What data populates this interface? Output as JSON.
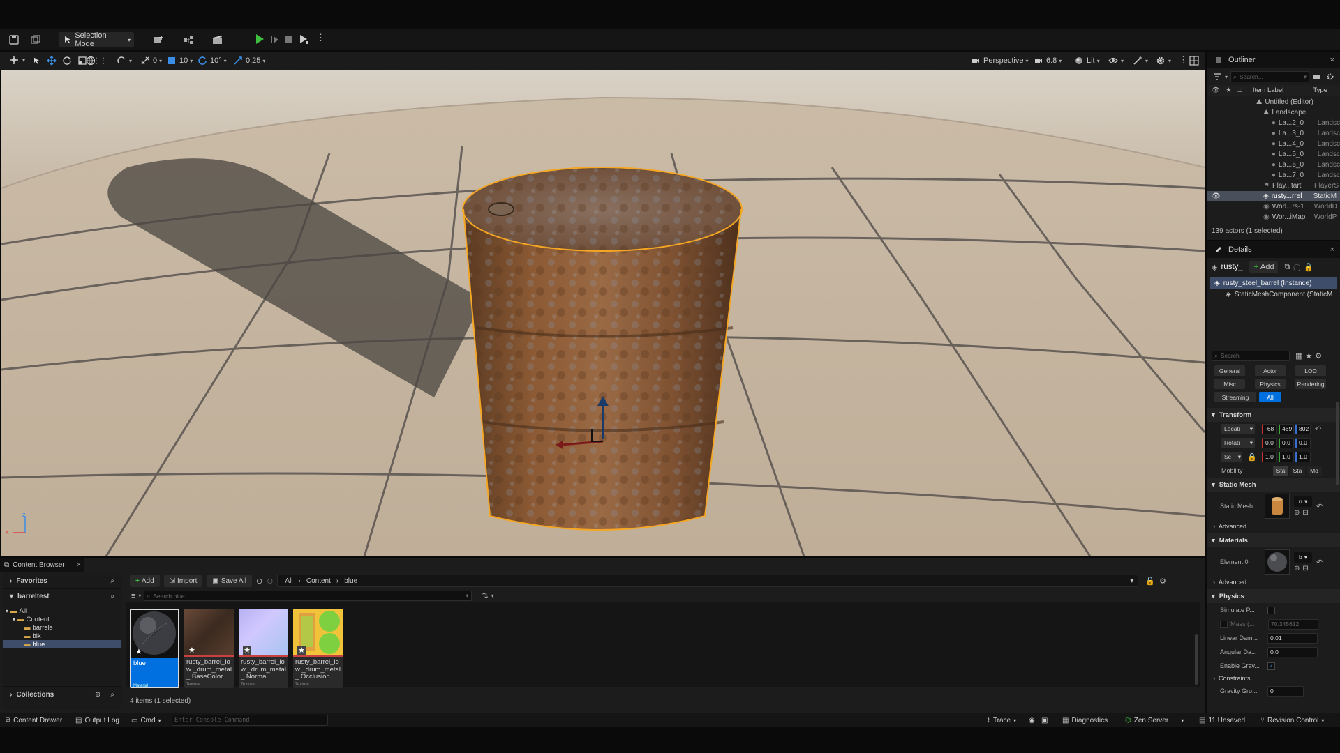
{
  "toolbar": {
    "selection_mode": "Selection Mode",
    "grid_snap": "0",
    "grid_size": "10",
    "rotation_snap": "10°",
    "scale_snap": "0.25"
  },
  "viewport": {
    "perspective": "Perspective",
    "camera_speed": "6.8",
    "view_mode": "Lit"
  },
  "outliner": {
    "tab": "Outliner",
    "search_placeholder": "Search...",
    "col_label": "Item Label",
    "col_type": "Type",
    "rows": [
      {
        "label": "Untitled (Editor)",
        "type": "",
        "indent": 0
      },
      {
        "label": "Landscape",
        "type": "",
        "indent": 1
      },
      {
        "label": "La...2_0",
        "type": "Landsc",
        "indent": 2
      },
      {
        "label": "La...3_0",
        "type": "Landsc",
        "indent": 2
      },
      {
        "label": "La...4_0",
        "type": "Landsc",
        "indent": 2
      },
      {
        "label": "La...5_0",
        "type": "Landsc",
        "indent": 2
      },
      {
        "label": "La...6_0",
        "type": "Landsc",
        "indent": 2
      },
      {
        "label": "La...7_0",
        "type": "Landsc",
        "indent": 2
      },
      {
        "label": "Play...tart",
        "type": "PlayerS",
        "indent": 1
      },
      {
        "label": "rusty...rrel",
        "type": "StaticM",
        "indent": 1,
        "selected": true
      },
      {
        "label": "Worl...rs-1",
        "type": "WorldD",
        "indent": 1
      },
      {
        "label": "Wor...iMap",
        "type": "WorldP",
        "indent": 1
      }
    ],
    "status": "139 actors (1 selected)"
  },
  "details": {
    "tab": "Details",
    "actor_name": "rusty_",
    "add_label": "Add",
    "component_root": "rusty_steel_barrel (Instance)",
    "component_child": "StaticMeshComponent (StaticM",
    "search_placeholder": "Search",
    "filters": [
      "General",
      "Actor",
      "LOD",
      "Misc",
      "Physics",
      "Rendering",
      "Streaming",
      "All"
    ],
    "transform": {
      "header": "Transform",
      "location_label": "Locati",
      "location": [
        "-68",
        "469",
        "802"
      ],
      "rotation_label": "Rotati",
      "rotation": [
        "0.0",
        "0.0",
        "0.0"
      ],
      "scale_label": "Sc",
      "scale": [
        "1.0",
        "1.0",
        "1.0"
      ],
      "mobility_label": "Mobility",
      "mobility": [
        "Sta",
        "Sta",
        "Mo"
      ]
    },
    "static_mesh": {
      "header": "Static Mesh",
      "label": "Static Mesh",
      "dropdown": "rı",
      "advanced": "Advanced"
    },
    "materials": {
      "header": "Materials",
      "label": "Element 0",
      "dropdown": "b",
      "advanced": "Advanced"
    },
    "physics": {
      "header": "Physics",
      "simulate": "Simulate P...",
      "mass_label": "Mass (...",
      "mass_value": "70.345612",
      "linear_damping_label": "Linear Dam...",
      "linear_damping": "0.01",
      "angular_damping_label": "Angular Da...",
      "angular_damping": "0.0",
      "enable_gravity_label": "Enable Grav...",
      "constraints": "Constraints",
      "gravity_group_label": "Gravity Gro...",
      "gravity_group": "0"
    }
  },
  "content_browser": {
    "tab": "Content Browser",
    "add": "Add",
    "import": "Import",
    "save_all": "Save All",
    "breadcrumb": [
      "All",
      "Content",
      "blue"
    ],
    "search_placeholder": "Search blue",
    "favorites": "Favorites",
    "project": "barreltest",
    "tree": [
      {
        "label": "All",
        "indent": 0
      },
      {
        "label": "Content",
        "indent": 1
      },
      {
        "label": "barrels",
        "indent": 2
      },
      {
        "label": "blk",
        "indent": 2
      },
      {
        "label": "blue",
        "indent": 2,
        "selected": true
      }
    ],
    "collections": "Collections",
    "assets": [
      {
        "name": "blue",
        "type": "Material"
      },
      {
        "name": "rusty_barrel_low_drum_metal_BaseColor",
        "type": "Texture"
      },
      {
        "name": "rusty_barrel_low_drum_metal_Normal",
        "type": "Texture"
      },
      {
        "name": "rusty_barrel_low_drum_metal_Occlusion...",
        "type": "Texture"
      }
    ],
    "asset_names": {
      "a0": "blue",
      "a1": "rusty_barrel_low _drum_metal_ BaseColor",
      "a2": "rusty_barrel_low _drum_metal_ Normal",
      "a3": "rusty_barrel_low _drum_metal_ Occlusion..."
    },
    "status": "4 items (1 selected)"
  },
  "bottom": {
    "content_drawer": "Content Drawer",
    "output_log": "Output Log",
    "cmd": "Cmd",
    "console_placeholder": "Enter Console Command",
    "trace": "Trace",
    "diagnostics": "Diagnostics",
    "zen": "Zen Server",
    "unsaved": "11 Unsaved",
    "revision": "Revision Control"
  },
  "colors": {
    "accent": "#0070e0",
    "selection_outline": "#f5a623",
    "play_green": "#3fbf3f"
  }
}
